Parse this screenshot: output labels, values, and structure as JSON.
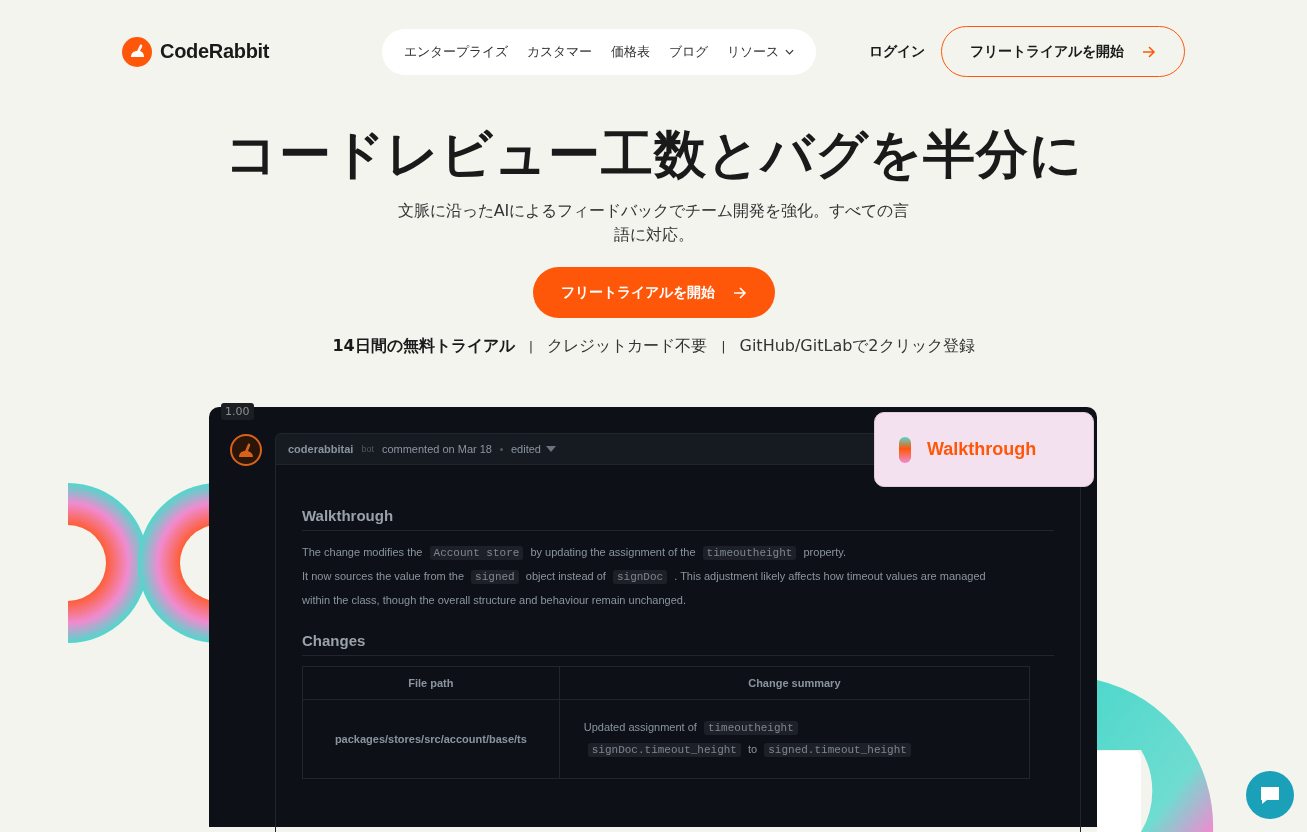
{
  "header": {
    "logo": "CodeRabbit",
    "nav": [
      {
        "label": "エンタープライズ",
        "has_menu": false
      },
      {
        "label": "カスタマー",
        "has_menu": false
      },
      {
        "label": "価格表",
        "has_menu": false
      },
      {
        "label": "ブログ",
        "has_menu": false
      },
      {
        "label": "リソース",
        "has_menu": true
      }
    ],
    "login": "ログイン",
    "cta": "フリートライアルを開始"
  },
  "hero": {
    "title": "コードレビュー工数とバグを半分に",
    "subtitle": "文脈に沿ったAIによるフィードバックでチーム開発を強化。すべての言語に対応。",
    "cta": "フリートライアルを開始",
    "separator": "|",
    "features": [
      {
        "text": "14日間の無料トライアル",
        "bold": true
      },
      {
        "text": "クレジットカード不要",
        "bold": false
      },
      {
        "text": "GitHub/GitLabで2クリック登録",
        "bold": false
      }
    ]
  },
  "preview": {
    "zoom": "1.00",
    "comment": {
      "author": "coderabbitai",
      "badge": "bot",
      "meta": "commented on Mar 18",
      "status": "edited"
    },
    "walkthrough_card": "Walkthrough",
    "walkthrough": {
      "heading": "Walkthrough",
      "paragraphs": [
        [
          {
            "kind": "text",
            "text": "The change modifies the"
          },
          {
            "kind": "code",
            "text": "Account store"
          },
          {
            "kind": "text",
            "text": "by updating the assignment of the"
          },
          {
            "kind": "code",
            "text": "timeoutheight"
          },
          {
            "kind": "text",
            "text": "property."
          }
        ],
        [
          {
            "kind": "text",
            "text": "It now sources the value from the"
          },
          {
            "kind": "code",
            "text": "signed"
          },
          {
            "kind": "text",
            "text": "object instead of"
          },
          {
            "kind": "code",
            "text": "signDoc"
          },
          {
            "kind": "text",
            "text": ". This adjustment likely affects how timeout values are managed within the class, though the overall structure and behaviour remain unchanged."
          }
        ]
      ]
    },
    "changes": {
      "heading": "Changes",
      "columns": [
        "File path",
        "Change summary"
      ],
      "rows": [
        [
          [
            {
              "kind": "text",
              "text": "packages/stores/src/account/base/ts"
            }
          ],
          [
            {
              "kind": "text",
              "text": "Updated assignment of"
            },
            {
              "kind": "code",
              "text": "timeoutheight"
            },
            {
              "kind": "break"
            },
            {
              "kind": "code",
              "text": "signDoc.timeout_height"
            },
            {
              "kind": "text",
              "text": "to"
            },
            {
              "kind": "code",
              "text": "signed.timeout_height"
            }
          ]
        ]
      ]
    }
  }
}
